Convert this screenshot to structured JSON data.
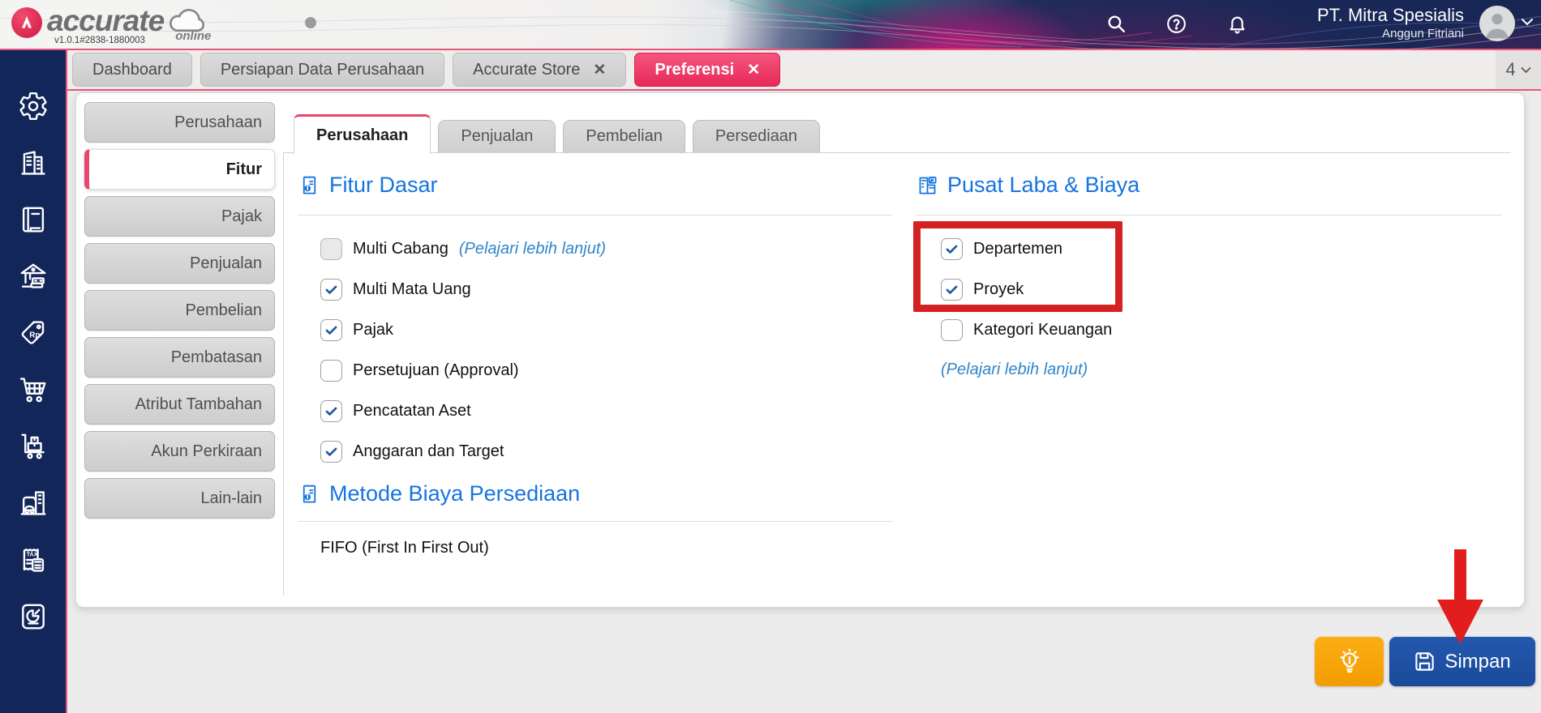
{
  "header": {
    "brand": "accurate",
    "brand_sub": "online",
    "version": "v1.0.1#2838-1880003",
    "company_name": "PT. Mitra Spesialis",
    "user_name": "Anggun Fitriani"
  },
  "tabbar": {
    "tabs": [
      {
        "label": "Dashboard",
        "closable": false,
        "active": false
      },
      {
        "label": "Persiapan Data Perusahaan",
        "closable": false,
        "active": false
      },
      {
        "label": "Accurate Store",
        "closable": true,
        "active": false
      },
      {
        "label": "Preferensi",
        "closable": true,
        "active": true
      }
    ],
    "close_glyph": "✕",
    "open_count": "4"
  },
  "sidebar_icons": [
    "settings-gear",
    "company-buildings",
    "journal-book",
    "bank-cash",
    "price-tag-rp",
    "shopping-cart",
    "inventory-trolley",
    "asset-building-car",
    "tax-documents",
    "report-pie-chart"
  ],
  "nav_menu": {
    "items": [
      {
        "label": "Perusahaan",
        "active": false
      },
      {
        "label": "Fitur",
        "active": true
      },
      {
        "label": "Pajak",
        "active": false
      },
      {
        "label": "Penjualan",
        "active": false
      },
      {
        "label": "Pembelian",
        "active": false
      },
      {
        "label": "Pembatasan",
        "active": false
      },
      {
        "label": "Atribut Tambahan",
        "active": false
      },
      {
        "label": "Akun Perkiraan",
        "active": false
      },
      {
        "label": "Lain-lain",
        "active": false
      }
    ]
  },
  "content_tabs": [
    {
      "label": "Perusahaan",
      "active": true
    },
    {
      "label": "Penjualan",
      "active": false
    },
    {
      "label": "Pembelian",
      "active": false
    },
    {
      "label": "Persediaan",
      "active": false
    }
  ],
  "fitur_dasar": {
    "title": "Fitur Dasar",
    "rows": [
      {
        "label": "Multi Cabang",
        "checked": false,
        "link": "(Pelajari lebih lanjut)"
      },
      {
        "label": "Multi Mata Uang",
        "checked": true
      },
      {
        "label": "Pajak",
        "checked": true
      },
      {
        "label": "Persetujuan (Approval)",
        "checked": false
      },
      {
        "label": "Pencatatan Aset",
        "checked": true
      },
      {
        "label": "Anggaran dan Target",
        "checked": true
      }
    ]
  },
  "metode_biaya": {
    "title": "Metode Biaya Persediaan",
    "value": "FIFO (First In First Out)"
  },
  "pusat_laba": {
    "title": "Pusat Laba & Biaya",
    "rows": [
      {
        "label": "Departemen",
        "checked": true,
        "highlighted": true
      },
      {
        "label": "Proyek",
        "checked": true,
        "highlighted": true
      },
      {
        "label": "Kategori Keuangan",
        "checked": false,
        "highlighted": false
      }
    ],
    "learn_more": "(Pelajari lebih lanjut)"
  },
  "footer": {
    "save_label": "Simpan"
  },
  "colors": {
    "accent_pink": "#e8486e",
    "heading_blue": "#1574e0",
    "link_blue": "#2f86cb",
    "check_blue": "#1d5a9c",
    "save_button_blue": "#1d4fa1",
    "hint_button_yellow": "#f7a50a",
    "annotation_red": "#d42222",
    "sidebar_navy": "#13265a"
  }
}
